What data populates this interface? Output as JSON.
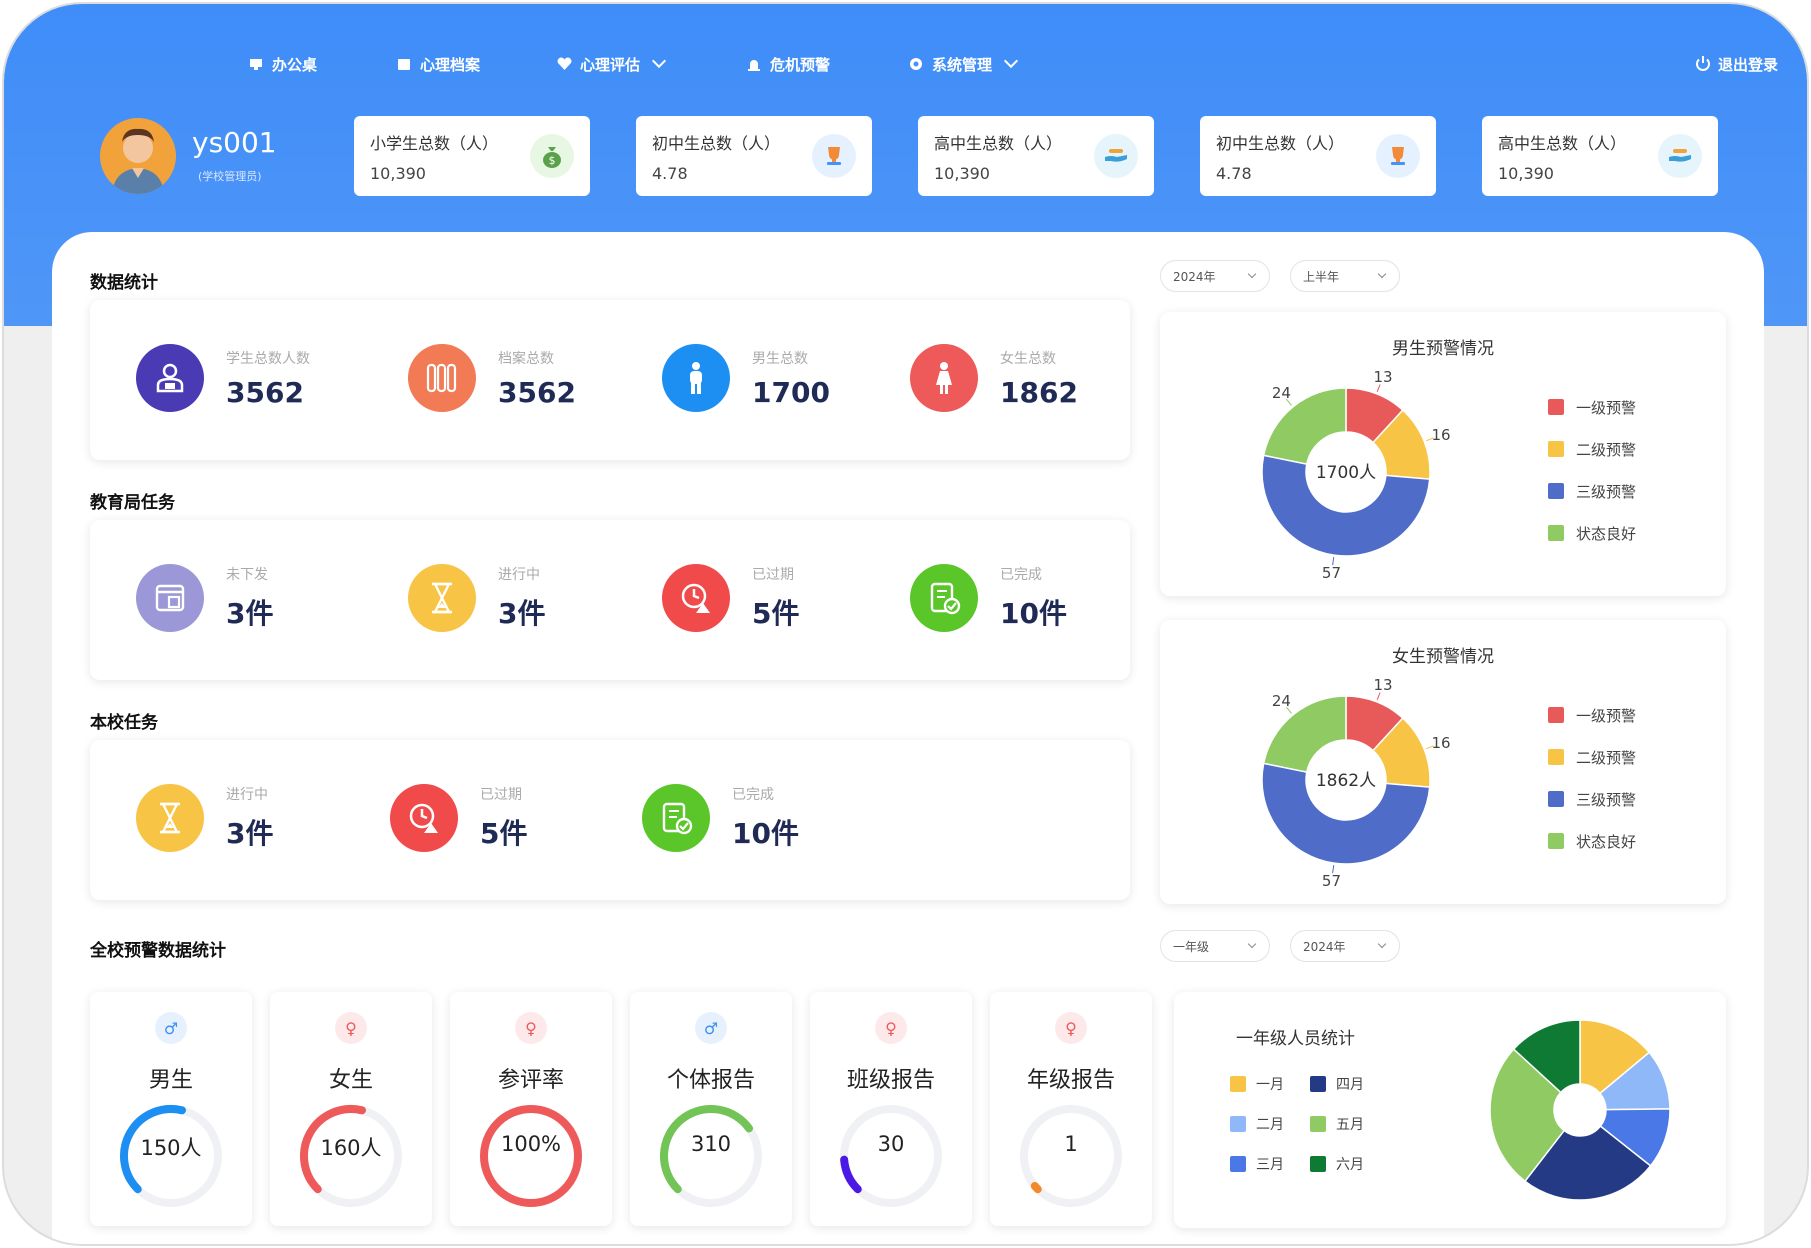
{
  "nav": {
    "items": [
      {
        "label": "办公桌",
        "icon": "desk-icon"
      },
      {
        "label": "心理档案",
        "icon": "folder-icon"
      },
      {
        "label": "心理评估",
        "icon": "heart-icon"
      },
      {
        "label": "危机预警",
        "icon": "alarm-icon"
      },
      {
        "label": "系统管理",
        "icon": "gear-icon"
      }
    ],
    "logout": "退出登录"
  },
  "user": {
    "name": "ys001",
    "role": "(学校管理员)"
  },
  "stat_cards": [
    {
      "label": "小学生总数（人）",
      "value": "10,390",
      "icon": "money-bag-icon",
      "color": "#e8f7e4"
    },
    {
      "label": "初中生总数（人）",
      "value": "4.78",
      "icon": "trophy-icon",
      "color": "#e6f1ff"
    },
    {
      "label": "高中生总数（人）",
      "value": "10,390",
      "icon": "hand-icon",
      "color": "#e6f5fb"
    },
    {
      "label": "初中生总数（人）",
      "value": "4.78",
      "icon": "trophy-icon",
      "color": "#e6f1ff"
    },
    {
      "label": "高中生总数（人）",
      "value": "10,390",
      "icon": "hand-icon",
      "color": "#e6f5fb"
    }
  ],
  "sections": {
    "data_stats": "数据统计",
    "edu_tasks": "教育局任务",
    "school_tasks": "本校任务",
    "warning_stats": "全校预警数据统计"
  },
  "data_stats": [
    {
      "label": "学生总数人数",
      "value": "3562",
      "color": "#4a3bb5",
      "icon": "student-icon"
    },
    {
      "label": "档案总数",
      "value": "3562",
      "color": "#f27a55",
      "icon": "archive-icon"
    },
    {
      "label": "男生总数",
      "value": "1700",
      "color": "#1d8ff2",
      "icon": "male-icon"
    },
    {
      "label": "女生总数",
      "value": "1862",
      "color": "#ee5a5a",
      "icon": "female-icon"
    }
  ],
  "edu_tasks": [
    {
      "label": "未下发",
      "value": "3件",
      "color": "#9c98d8",
      "icon": "inbox-icon"
    },
    {
      "label": "进行中",
      "value": "3件",
      "color": "#f7c445",
      "icon": "hourglass-icon"
    },
    {
      "label": "已过期",
      "value": "5件",
      "color": "#f04a4a",
      "icon": "clock-alert-icon"
    },
    {
      "label": "已完成",
      "value": "10件",
      "color": "#5bc62a",
      "icon": "checklist-icon"
    }
  ],
  "school_tasks": [
    {
      "label": "进行中",
      "value": "3件",
      "color": "#f7c445",
      "icon": "hourglass-icon"
    },
    {
      "label": "已过期",
      "value": "5件",
      "color": "#f04a4a",
      "icon": "clock-alert-icon"
    },
    {
      "label": "已完成",
      "value": "10件",
      "color": "#5bc62a",
      "icon": "checklist-icon"
    }
  ],
  "filters": {
    "year": "2024年",
    "half": "上半年",
    "grade": "一年级",
    "year2": "2024年"
  },
  "warning_legend": [
    "一级预警",
    "二级预警",
    "三级预警",
    "状态良好"
  ],
  "warning_colors": [
    "#e85a5a",
    "#f7c445",
    "#4f6cc9",
    "#8fcb62"
  ],
  "chart_data": [
    {
      "type": "pie",
      "title": "男生预警情况",
      "center_label": "1700人",
      "categories": [
        "一级预警",
        "二级预警",
        "三级预警",
        "状态良好"
      ],
      "values": [
        13,
        16,
        57,
        24
      ]
    },
    {
      "type": "pie",
      "title": "女生预警情况",
      "center_label": "1862人",
      "categories": [
        "一级预警",
        "二级预警",
        "三级预警",
        "状态良好"
      ],
      "values": [
        13,
        16,
        57,
        24
      ]
    },
    {
      "type": "pie",
      "title": "一年级人员统计",
      "categories": [
        "一月",
        "二月",
        "三月",
        "四月",
        "五月",
        "六月"
      ],
      "values": [
        18,
        14,
        14,
        32,
        34,
        17
      ],
      "colors": [
        "#f7c445",
        "#8fb8f8",
        "#4a78e6",
        "#243a85",
        "#8fcb62",
        "#0e7a34"
      ]
    }
  ],
  "gauges": [
    {
      "title": "男生",
      "value": "150人",
      "fraction": 0.55,
      "color": "#1d8ff2",
      "icon": "male-icon",
      "iconColor": "#3a8ff2",
      "iconBg": "#e7f1fd"
    },
    {
      "title": "女生",
      "value": "160人",
      "fraction": 0.55,
      "color": "#ee5a5a",
      "icon": "female-icon",
      "iconColor": "#ee5a5a",
      "iconBg": "#fde9e9"
    },
    {
      "title": "参评率",
      "value": "100%",
      "fraction": 1.0,
      "color": "#ee5a5a",
      "icon": "female-icon",
      "iconColor": "#ee5a5a",
      "iconBg": "#fde9e9"
    },
    {
      "title": "个体报告",
      "value": "310",
      "fraction": 0.7,
      "color": "#72c456",
      "icon": "male-icon",
      "iconColor": "#3a8ff2",
      "iconBg": "#e7f1fd"
    },
    {
      "title": "班级报告",
      "value": "30",
      "fraction": 0.15,
      "color": "#4b18e6",
      "icon": "female-icon",
      "iconColor": "#ee5a5a",
      "iconBg": "#fde9e9"
    },
    {
      "title": "年级报告",
      "value": "1",
      "fraction": 0.02,
      "color": "#f28a2a",
      "icon": "female-icon",
      "iconColor": "#ee5a5a",
      "iconBg": "#fde9e9"
    }
  ]
}
